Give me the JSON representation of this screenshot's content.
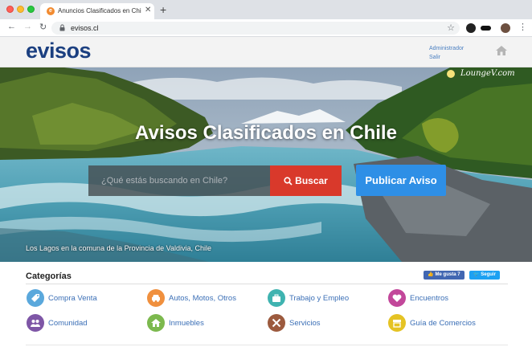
{
  "browser": {
    "tab_title": "Anuncios Clasificados en Chile",
    "favicon_letter": "e",
    "new_tab_symbol": "+",
    "close_symbol": "✕",
    "url": "evisos.cl"
  },
  "site": {
    "logo": "evisos",
    "admin_link": "Administrador",
    "logout_link": "Salir"
  },
  "hero": {
    "watermark": "LoungeV.com",
    "title": "Avisos Clasificados en Chile",
    "search_placeholder": "¿Qué estás buscando en Chile?",
    "search_button": "Buscar",
    "publish_button": "Publicar Aviso",
    "caption": "Los Lagos en la comuna de la Provincia de Valdivia, Chile"
  },
  "categories": {
    "heading": "Categorías",
    "facebook_label": "👍 Me gusta 7",
    "twitter_label": "🐦 Seguir",
    "items": [
      {
        "label": "Compra Venta",
        "color": "#5aa8dc",
        "icon": "tag-icon"
      },
      {
        "label": "Autos, Motos, Otros",
        "color": "#f0903e",
        "icon": "car-icon"
      },
      {
        "label": "Trabajo y Empleo",
        "color": "#3fb3b0",
        "icon": "briefcase-icon"
      },
      {
        "label": "Encuentros",
        "color": "#c2479a",
        "icon": "heart-icon"
      },
      {
        "label": "Comunidad",
        "color": "#7e56a6",
        "icon": "people-icon"
      },
      {
        "label": "Inmuebles",
        "color": "#7cb94e",
        "icon": "house-icon"
      },
      {
        "label": "Servicios",
        "color": "#9c5a3e",
        "icon": "tools-icon"
      },
      {
        "label": "Guía de Comercios",
        "color": "#e5c324",
        "icon": "store-icon"
      }
    ]
  }
}
